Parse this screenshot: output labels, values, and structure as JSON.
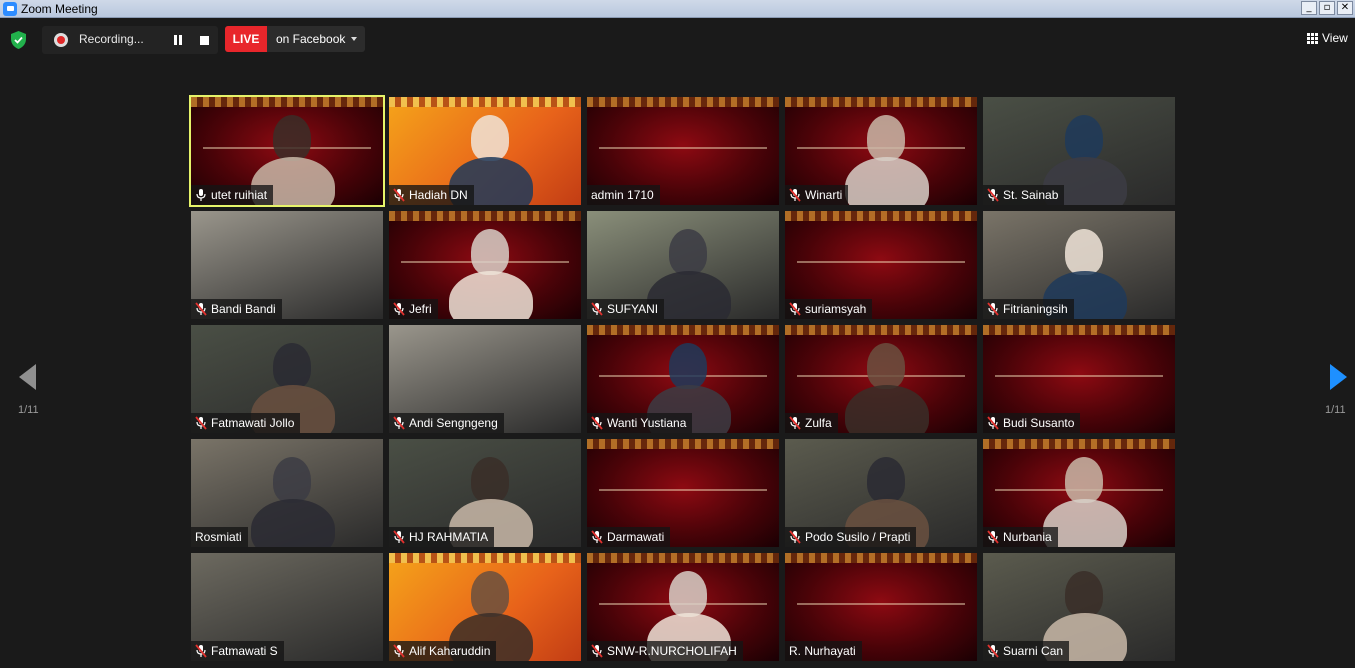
{
  "window": {
    "title": "Zoom Meeting",
    "buttons": [
      "_",
      "▫",
      "✕"
    ]
  },
  "toolbar": {
    "recording_label": "Recording...",
    "live_badge": "LIVE",
    "live_target": "on Facebook",
    "view_label": "View"
  },
  "pagination": {
    "left": "1/11",
    "right": "1/11"
  },
  "participants": [
    {
      "name": "utet ruihiat",
      "muted": false,
      "style": "banner",
      "active": true
    },
    {
      "name": "Hadiah DN",
      "muted": true,
      "style": "orange"
    },
    {
      "name": "admin 1710",
      "muted": false,
      "style": "banner"
    },
    {
      "name": "Winarti",
      "muted": true,
      "style": "banner"
    },
    {
      "name": "St. Sainab",
      "muted": true,
      "style": "cam"
    },
    {
      "name": "Bandi Bandi",
      "muted": true,
      "style": "cam"
    },
    {
      "name": "Jefri",
      "muted": true,
      "style": "banner"
    },
    {
      "name": "SUFYANI",
      "muted": true,
      "style": "cam"
    },
    {
      "name": "suriamsyah",
      "muted": true,
      "style": "banner"
    },
    {
      "name": "Fitrianingsih",
      "muted": true,
      "style": "cam"
    },
    {
      "name": "Fatmawati Jollo",
      "muted": true,
      "style": "cam"
    },
    {
      "name": "Andi Sengngeng",
      "muted": true,
      "style": "cam"
    },
    {
      "name": "Wanti Yustiana",
      "muted": true,
      "style": "banner"
    },
    {
      "name": "Zulfa",
      "muted": true,
      "style": "banner"
    },
    {
      "name": "Budi Susanto",
      "muted": true,
      "style": "banner"
    },
    {
      "name": "Rosmiati",
      "muted": false,
      "style": "cam"
    },
    {
      "name": "HJ RAHMATIA",
      "muted": true,
      "style": "cam"
    },
    {
      "name": "Darmawati",
      "muted": true,
      "style": "banner"
    },
    {
      "name": "Podo Susilo / Prapti",
      "muted": true,
      "style": "cam"
    },
    {
      "name": "Nurbania",
      "muted": true,
      "style": "banner"
    },
    {
      "name": "Fatmawati S",
      "muted": true,
      "style": "cam"
    },
    {
      "name": "Alif Kaharuddin",
      "muted": true,
      "style": "orange"
    },
    {
      "name": "SNW-R.NURCHOLIFAH",
      "muted": true,
      "style": "banner"
    },
    {
      "name": "R. Nurhayati",
      "muted": false,
      "style": "banner"
    },
    {
      "name": "Suarni Can",
      "muted": true,
      "style": "cam"
    }
  ],
  "colors": {
    "live": "#e8262b",
    "active_border": "#e6f46a",
    "next_arrow": "#1e90ff",
    "muted_mic": "#e0312e"
  }
}
